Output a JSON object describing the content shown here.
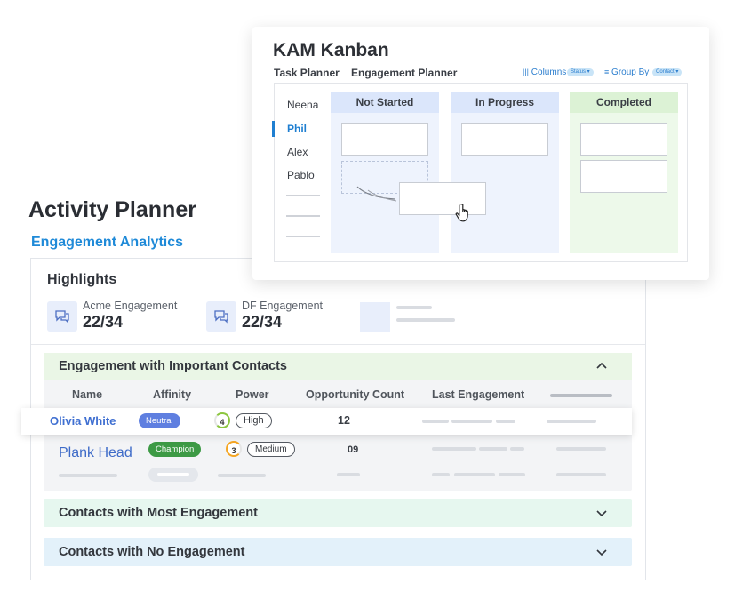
{
  "page": {
    "title": "Activity Planner",
    "subtitle": "Engagement Analytics"
  },
  "highlights": {
    "title": "Highlights",
    "metrics": [
      {
        "label": "Acme Engagement",
        "value": "22/34",
        "icon": "chat-icon"
      },
      {
        "label": "DF Engagement",
        "value": "22/34",
        "icon": "chat-icon"
      }
    ]
  },
  "sections": {
    "important": {
      "title": "Engagement with Important Contacts",
      "columns": [
        "Name",
        "Affinity",
        "Power",
        "Opportunity Count",
        "Last Engagement"
      ],
      "rows": [
        {
          "name": "Olivia White",
          "affinity": "Neutral",
          "power_score": "4",
          "power": "High",
          "opportunity_count": "12"
        },
        {
          "name": "Plank Head",
          "affinity": "Champion",
          "power_score": "3",
          "power": "Medium",
          "opportunity_count": "09"
        }
      ]
    },
    "most": {
      "title": "Contacts with Most Engagement"
    },
    "none": {
      "title": "Contacts with No Engagement"
    }
  },
  "kanban": {
    "title": "KAM Kanban",
    "tabs": [
      "Task Planner",
      "Engagement Planner"
    ],
    "columns_control": {
      "label": "Columns",
      "chip": "Status ▾"
    },
    "group_by_control": {
      "label": "Group By",
      "chip": "Contact ▾"
    },
    "people": [
      "Neena",
      "Phil",
      "Alex",
      "Pablo"
    ],
    "active_person": "Phil",
    "lanes": [
      "Not Started",
      "In Progress",
      "Completed"
    ]
  },
  "colors": {
    "accent": "#1f8ad8",
    "neutral_badge": "#5f7fe0",
    "champion_badge": "#3d9a45",
    "high_ring": "#8cc63f",
    "medium_ring": "#f5a623"
  }
}
